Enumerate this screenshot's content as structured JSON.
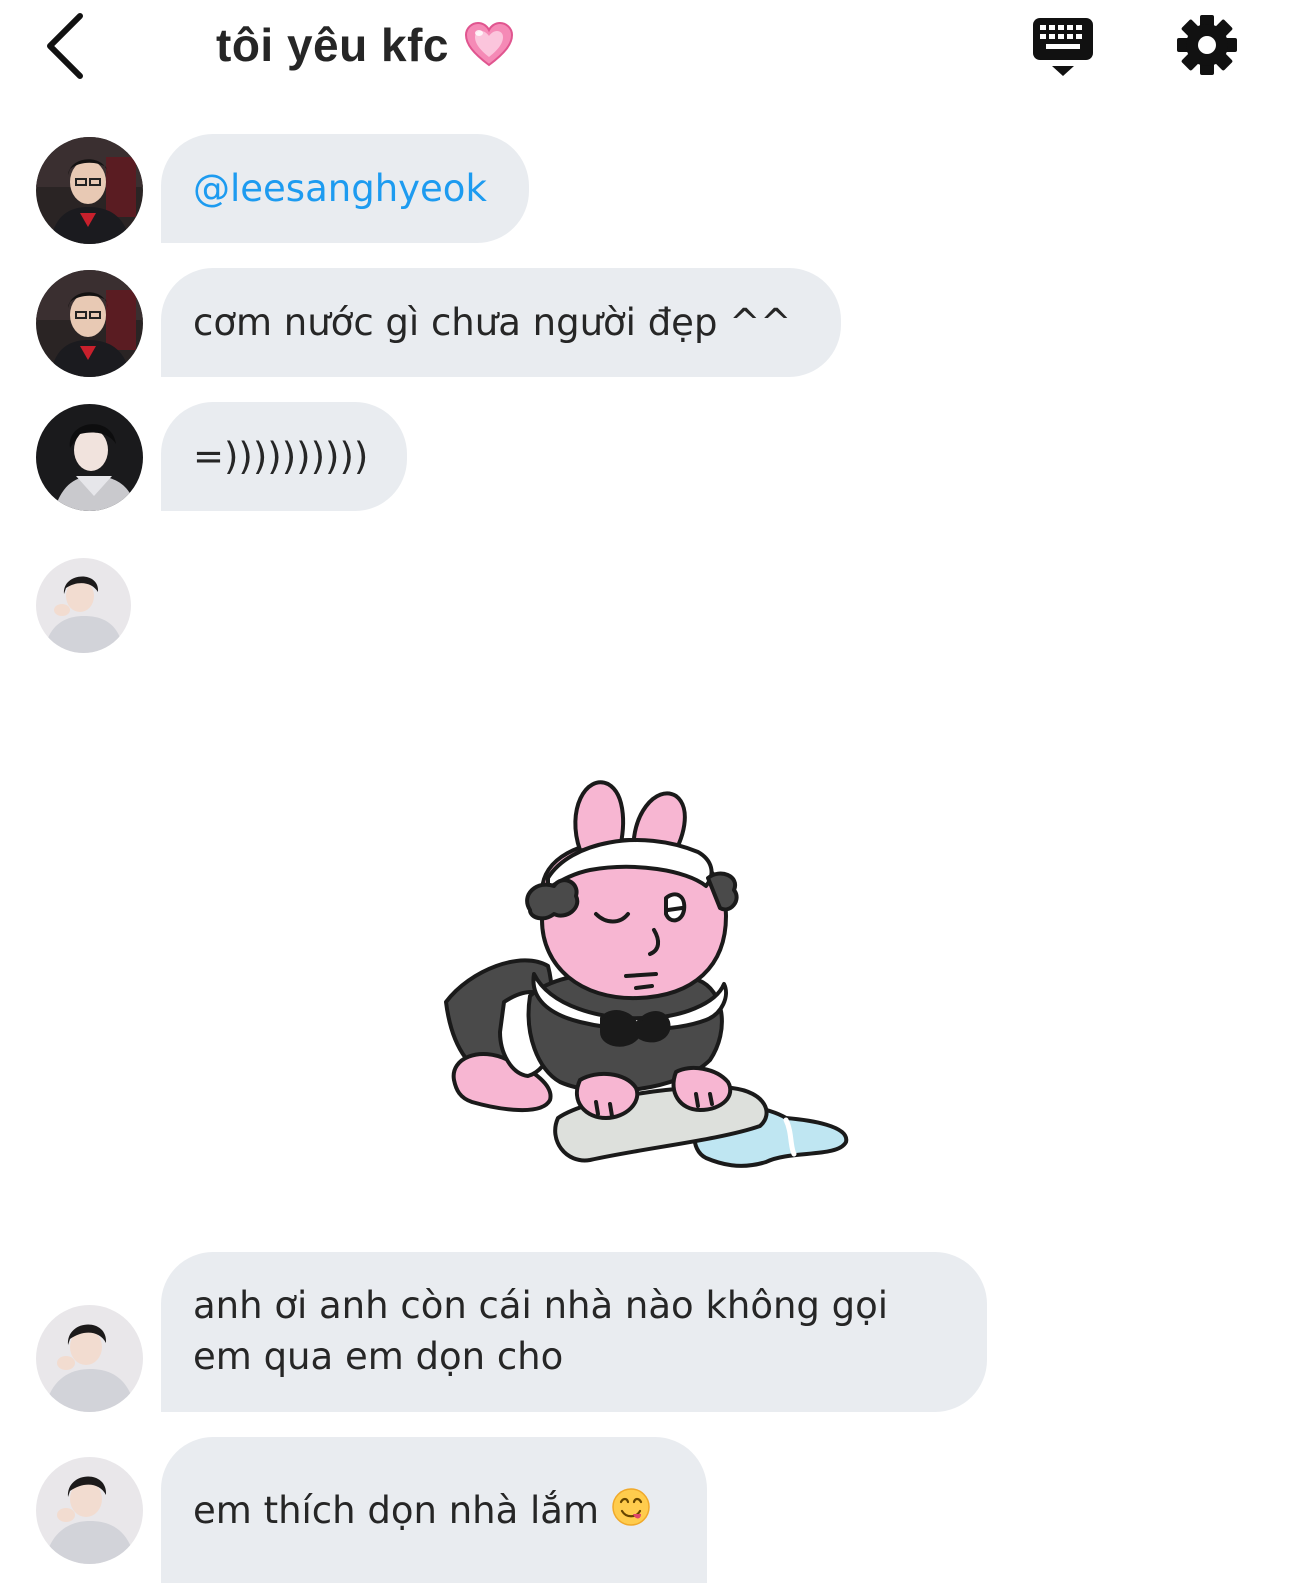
{
  "header": {
    "title": "tôi yêu kfc",
    "title_emoji": "pink-heart-icon",
    "back_icon": "chevron-left-icon",
    "keyboard_icon": "keyboard-icon",
    "settings_icon": "gear-icon"
  },
  "messages": [
    {
      "sender": "user-a",
      "text": "@leesanghyeok",
      "type": "mention"
    },
    {
      "sender": "user-a",
      "text": "cơm nước gì chưa người đẹp ^^",
      "type": "text"
    },
    {
      "sender": "user-b",
      "text": "=))))))))))",
      "type": "text"
    },
    {
      "sender": "user-c",
      "type": "sticker",
      "sticker": "pink-bunny-maid-cleaning-sticker"
    },
    {
      "sender": "user-c",
      "text": "anh ơi anh còn cái nhà nào không gọi em qua em dọn cho",
      "line1": "anh ơi anh còn cái nhà nào không gọi",
      "line2": "em qua em dọn cho",
      "type": "text"
    },
    {
      "sender": "user-c",
      "text": "em thích dọn nhà lắm",
      "emoji": "yum-face-icon",
      "type": "text"
    }
  ],
  "colors": {
    "bubble": "#e9ecf0",
    "mention": "#1d9bf0",
    "text": "#262626",
    "accent_pink": "#f7b6d2"
  }
}
